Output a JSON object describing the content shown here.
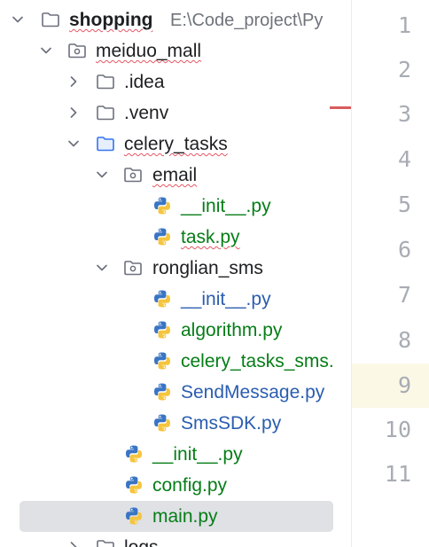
{
  "project": {
    "root_label": "shopping",
    "root_path": "E:\\Code_project\\Py"
  },
  "tree": {
    "meiduo_mall": "meiduo_mall",
    "idea": ".idea",
    "venv": ".venv",
    "celery_tasks": "celery_tasks",
    "email": "email",
    "email_init": "__init__.py",
    "email_task": "task.py",
    "ronglian_sms": "ronglian_sms",
    "sms_init": "__init__.py",
    "sms_algorithm": "algorithm.py",
    "sms_celery_tasks": "celery_tasks_sms.",
    "sms_sendmessage": "SendMessage.py",
    "sms_smssdk": "SmsSDK.py",
    "ct_init": "__init__.py",
    "ct_config": "config.py",
    "ct_main": "main.py",
    "logs": "logs"
  },
  "gutter": {
    "line_numbers": [
      "1",
      "2",
      "3",
      "4",
      "5",
      "6",
      "7",
      "8",
      "9",
      "10",
      "11"
    ],
    "current_line": "9"
  },
  "colors": {
    "python_file": "#067d17",
    "modified_file": "#2a5db0",
    "selection": "#dfe1e5",
    "error_underline": "#e55765"
  },
  "icons": {
    "folder": "folder-icon",
    "package": "package-icon",
    "python": "python-file-icon",
    "chevron_open": "chevron-down-icon",
    "chevron_closed": "chevron-right-icon"
  }
}
